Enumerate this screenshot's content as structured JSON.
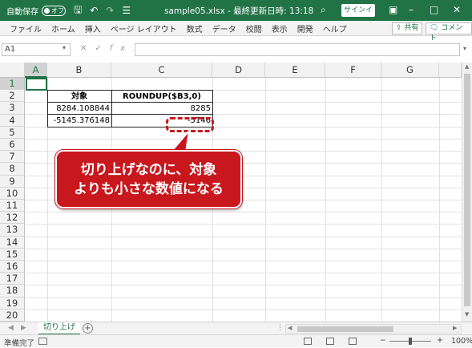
{
  "titlebar": {
    "autosave_label": "自動保存",
    "autosave_state": "オフ",
    "title": "sample05.xlsx  -  最終更新日時: 13:18",
    "signin": "サインイン"
  },
  "ribbon": {
    "tabs": [
      "ファイル",
      "ホーム",
      "挿入",
      "ページ レイアウト",
      "数式",
      "データ",
      "校閲",
      "表示",
      "開発",
      "ヘルプ"
    ],
    "share": "共有",
    "comment": "コメント"
  },
  "formula_bar": {
    "name_box": "A1",
    "fx": "fx",
    "content": ""
  },
  "grid": {
    "columns": [
      "A",
      "B",
      "C",
      "D",
      "E",
      "F",
      "G"
    ],
    "rows": [
      "1",
      "2",
      "3",
      "4",
      "5",
      "6",
      "7",
      "8",
      "9",
      "10",
      "11",
      "12",
      "13",
      "14",
      "15",
      "16",
      "17",
      "18",
      "19",
      "20"
    ],
    "table": {
      "header_b": "対象",
      "header_c": "ROUNDUP($B3,0)",
      "b3": "8284.108844",
      "c3": "8285",
      "b4": "-5145.376148",
      "c4": "-5146"
    }
  },
  "callout": {
    "line1": "切り上げなのに、対象",
    "line2": "よりも小さな数値になる",
    "color": "#c8181e"
  },
  "sheet_tabs": {
    "active": "切り上げ"
  },
  "statusbar": {
    "status": "準備完了",
    "zoom": "100%"
  }
}
